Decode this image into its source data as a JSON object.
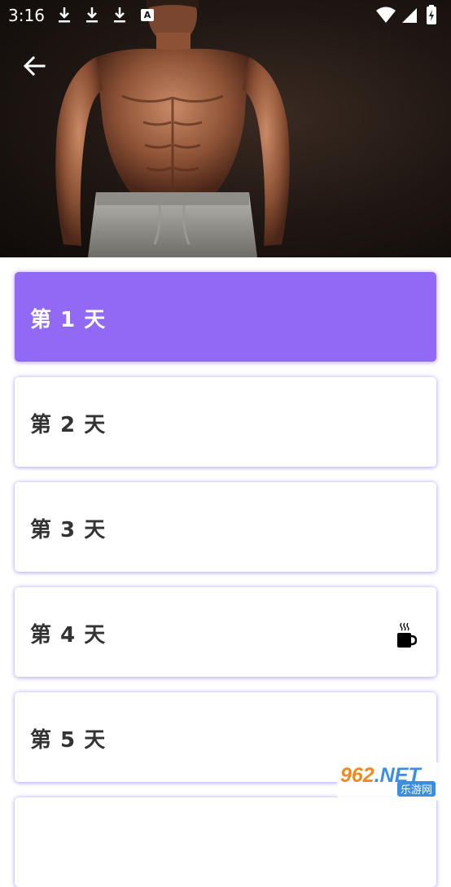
{
  "status_bar": {
    "time": "3:16",
    "notification_icons": [
      "download-icon",
      "download-icon",
      "download-icon",
      "a-icon"
    ],
    "a_label": "A",
    "right_icons": [
      "wifi-icon",
      "signal-icon",
      "battery-charging-icon"
    ]
  },
  "header": {
    "image": "muscular-man-torso-photo",
    "back_icon": "arrow-left-icon"
  },
  "days": [
    {
      "label": "第 1 天",
      "active": true
    },
    {
      "label": "第 2 天",
      "active": false
    },
    {
      "label": "第 3 天",
      "active": false
    },
    {
      "label": "第 4 天",
      "active": false,
      "icon": "coffee-cup-icon"
    },
    {
      "label": "第 5 天",
      "active": false
    }
  ],
  "watermark": {
    "top": "962",
    "top_suffix": ".NET",
    "bottom": "乐游网"
  },
  "colors": {
    "accent": "#9169f5",
    "card_shadow": "#8c6ef0",
    "text": "#333333"
  }
}
